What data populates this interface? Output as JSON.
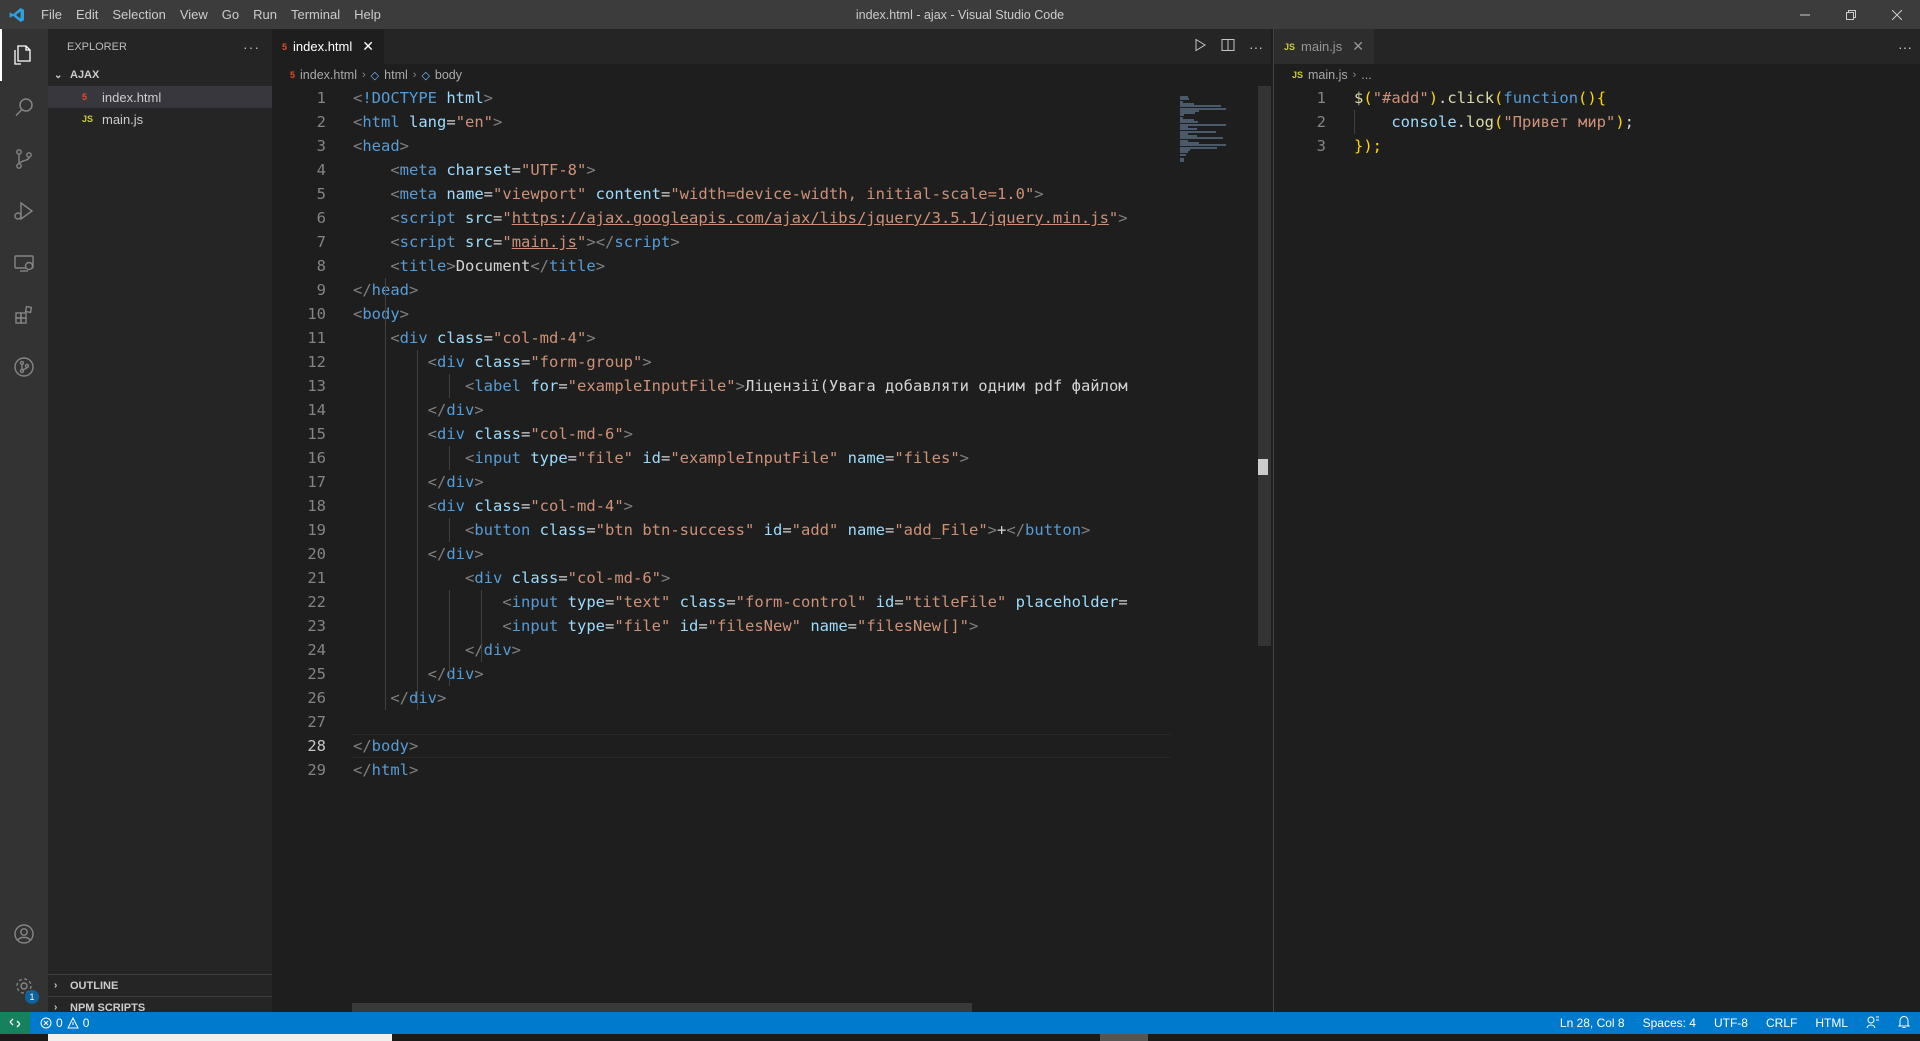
{
  "titlebar": {
    "menu": [
      "File",
      "Edit",
      "Selection",
      "View",
      "Go",
      "Run",
      "Terminal",
      "Help"
    ],
    "title": "index.html - ajax - Visual Studio Code",
    "minimize_icon": "minimize-icon",
    "restore_icon": "restore-icon",
    "close_icon": "close-icon"
  },
  "activitybar": {
    "icons": [
      "explorer-icon",
      "search-icon",
      "source-control-icon",
      "run-debug-icon",
      "remote-explorer-icon",
      "extensions-icon",
      "git-graph-icon"
    ],
    "bottom_icons": [
      "account-icon",
      "settings-gear-icon"
    ],
    "settings_badge": "1"
  },
  "sidebar": {
    "title": "EXPLORER",
    "more": "···",
    "folder": "AJAX",
    "files": [
      {
        "name": "index.html",
        "type": "html",
        "selected": true
      },
      {
        "name": "main.js",
        "type": "js",
        "selected": false
      }
    ],
    "outline": "OUTLINE",
    "npm_scripts": "NPM SCRIPTS"
  },
  "editor1": {
    "tab_label": "index.html",
    "tab_icon_text": "5",
    "tab_close": "✕",
    "actions": [
      "run-icon",
      "split-editor-icon",
      "more-actions-icon"
    ],
    "more": "···",
    "breadcrumb": [
      "index.html",
      "html",
      "body"
    ],
    "current_line": 28,
    "lines": [
      [
        [
          "t-punct",
          "<"
        ],
        [
          "t-tag",
          "!DOCTYPE "
        ],
        [
          "t-attr",
          "html"
        ],
        [
          "t-punct",
          ">"
        ]
      ],
      [
        [
          "t-punct",
          "<"
        ],
        [
          "t-tag",
          "html "
        ],
        [
          "t-attr",
          "lang"
        ],
        [
          "t-text",
          "="
        ],
        [
          "t-str",
          "\"en\""
        ],
        [
          "t-punct",
          ">"
        ]
      ],
      [
        [
          "t-punct",
          "<"
        ],
        [
          "t-tag",
          "head"
        ],
        [
          "t-punct",
          ">"
        ]
      ],
      [
        [
          "t-text",
          "    "
        ],
        [
          "t-punct",
          "<"
        ],
        [
          "t-tag",
          "meta "
        ],
        [
          "t-attr",
          "charset"
        ],
        [
          "t-text",
          "="
        ],
        [
          "t-str",
          "\"UTF-8\""
        ],
        [
          "t-punct",
          ">"
        ]
      ],
      [
        [
          "t-text",
          "    "
        ],
        [
          "t-punct",
          "<"
        ],
        [
          "t-tag",
          "meta "
        ],
        [
          "t-attr",
          "name"
        ],
        [
          "t-text",
          "="
        ],
        [
          "t-str",
          "\"viewport\" "
        ],
        [
          "t-attr",
          "content"
        ],
        [
          "t-text",
          "="
        ],
        [
          "t-str",
          "\"width=device-width, initial-scale=1.0\""
        ],
        [
          "t-punct",
          ">"
        ]
      ],
      [
        [
          "t-text",
          "    "
        ],
        [
          "t-punct",
          "<"
        ],
        [
          "t-tag",
          "script "
        ],
        [
          "t-attr",
          "src"
        ],
        [
          "t-text",
          "="
        ],
        [
          "t-str",
          "\""
        ],
        [
          "t-link",
          "https://ajax.googleapis.com/ajax/libs/jquery/3.5.1/jquery.min.js"
        ],
        [
          "t-str",
          "\""
        ],
        [
          "t-punct",
          ">"
        ]
      ],
      [
        [
          "t-text",
          "    "
        ],
        [
          "t-punct",
          "<"
        ],
        [
          "t-tag",
          "script "
        ],
        [
          "t-attr",
          "src"
        ],
        [
          "t-text",
          "="
        ],
        [
          "t-str",
          "\""
        ],
        [
          "t-link",
          "main.js"
        ],
        [
          "t-str",
          "\""
        ],
        [
          "t-punct",
          "></"
        ],
        [
          "t-tag",
          "script"
        ],
        [
          "t-punct",
          ">"
        ]
      ],
      [
        [
          "t-text",
          "    "
        ],
        [
          "t-punct",
          "<"
        ],
        [
          "t-tag",
          "title"
        ],
        [
          "t-punct",
          ">"
        ],
        [
          "t-text",
          "Document"
        ],
        [
          "t-punct",
          "</"
        ],
        [
          "t-tag",
          "title"
        ],
        [
          "t-punct",
          ">"
        ]
      ],
      [
        [
          "t-punct",
          "</"
        ],
        [
          "t-tag",
          "head"
        ],
        [
          "t-punct",
          ">"
        ]
      ],
      [
        [
          "t-punct",
          "<"
        ],
        [
          "t-tag",
          "body"
        ],
        [
          "t-punct",
          ">"
        ]
      ],
      [
        [
          "t-text",
          "    "
        ],
        [
          "t-punct",
          "<"
        ],
        [
          "t-tag",
          "div "
        ],
        [
          "t-attr",
          "class"
        ],
        [
          "t-text",
          "="
        ],
        [
          "t-str",
          "\"col-md-4\""
        ],
        [
          "t-punct",
          ">"
        ]
      ],
      [
        [
          "t-text",
          "        "
        ],
        [
          "t-punct",
          "<"
        ],
        [
          "t-tag",
          "div "
        ],
        [
          "t-attr",
          "class"
        ],
        [
          "t-text",
          "="
        ],
        [
          "t-str",
          "\"form-group\""
        ],
        [
          "t-punct",
          ">"
        ]
      ],
      [
        [
          "t-text",
          "            "
        ],
        [
          "t-punct",
          "<"
        ],
        [
          "t-tag",
          "label "
        ],
        [
          "t-attr",
          "for"
        ],
        [
          "t-text",
          "="
        ],
        [
          "t-str",
          "\"exampleInputFile\""
        ],
        [
          "t-punct",
          ">"
        ],
        [
          "t-text",
          "Ліцензії(Увага добавляти одним pdf файлом"
        ]
      ],
      [
        [
          "t-text",
          "        "
        ],
        [
          "t-punct",
          "</"
        ],
        [
          "t-tag",
          "div"
        ],
        [
          "t-punct",
          ">"
        ]
      ],
      [
        [
          "t-text",
          "        "
        ],
        [
          "t-punct",
          "<"
        ],
        [
          "t-tag",
          "div "
        ],
        [
          "t-attr",
          "class"
        ],
        [
          "t-text",
          "="
        ],
        [
          "t-str",
          "\"col-md-6\""
        ],
        [
          "t-punct",
          ">"
        ]
      ],
      [
        [
          "t-text",
          "            "
        ],
        [
          "t-punct",
          "<"
        ],
        [
          "t-tag",
          "input "
        ],
        [
          "t-attr",
          "type"
        ],
        [
          "t-text",
          "="
        ],
        [
          "t-str",
          "\"file\" "
        ],
        [
          "t-attr",
          "id"
        ],
        [
          "t-text",
          "="
        ],
        [
          "t-str",
          "\"exampleInputFile\" "
        ],
        [
          "t-attr",
          "name"
        ],
        [
          "t-text",
          "="
        ],
        [
          "t-str",
          "\"files\""
        ],
        [
          "t-punct",
          ">"
        ]
      ],
      [
        [
          "t-text",
          "        "
        ],
        [
          "t-punct",
          "</"
        ],
        [
          "t-tag",
          "div"
        ],
        [
          "t-punct",
          ">"
        ]
      ],
      [
        [
          "t-text",
          "        "
        ],
        [
          "t-punct",
          "<"
        ],
        [
          "t-tag",
          "div "
        ],
        [
          "t-attr",
          "class"
        ],
        [
          "t-text",
          "="
        ],
        [
          "t-str",
          "\"col-md-4\""
        ],
        [
          "t-punct",
          ">"
        ]
      ],
      [
        [
          "t-text",
          "            "
        ],
        [
          "t-punct",
          "<"
        ],
        [
          "t-tag",
          "button "
        ],
        [
          "t-attr",
          "class"
        ],
        [
          "t-text",
          "="
        ],
        [
          "t-str",
          "\"btn btn-success\" "
        ],
        [
          "t-attr",
          "id"
        ],
        [
          "t-text",
          "="
        ],
        [
          "t-str",
          "\"add\" "
        ],
        [
          "t-attr",
          "name"
        ],
        [
          "t-text",
          "="
        ],
        [
          "t-str",
          "\"add_File\""
        ],
        [
          "t-punct",
          ">"
        ],
        [
          "t-text",
          "+"
        ],
        [
          "t-punct",
          "</"
        ],
        [
          "t-tag",
          "button"
        ],
        [
          "t-punct",
          ">"
        ]
      ],
      [
        [
          "t-text",
          "        "
        ],
        [
          "t-punct",
          "</"
        ],
        [
          "t-tag",
          "div"
        ],
        [
          "t-punct",
          ">"
        ]
      ],
      [
        [
          "t-text",
          "            "
        ],
        [
          "t-punct",
          "<"
        ],
        [
          "t-tag",
          "div "
        ],
        [
          "t-attr",
          "class"
        ],
        [
          "t-text",
          "="
        ],
        [
          "t-str",
          "\"col-md-6\""
        ],
        [
          "t-punct",
          ">"
        ]
      ],
      [
        [
          "t-text",
          "                "
        ],
        [
          "t-punct",
          "<"
        ],
        [
          "t-tag",
          "input "
        ],
        [
          "t-attr",
          "type"
        ],
        [
          "t-text",
          "="
        ],
        [
          "t-str",
          "\"text\" "
        ],
        [
          "t-attr",
          "class"
        ],
        [
          "t-text",
          "="
        ],
        [
          "t-str",
          "\"form-control\" "
        ],
        [
          "t-attr",
          "id"
        ],
        [
          "t-text",
          "="
        ],
        [
          "t-str",
          "\"titleFile\" "
        ],
        [
          "t-attr",
          "placeholder"
        ],
        [
          "t-text",
          "="
        ]
      ],
      [
        [
          "t-text",
          "                "
        ],
        [
          "t-punct",
          "<"
        ],
        [
          "t-tag",
          "input "
        ],
        [
          "t-attr",
          "type"
        ],
        [
          "t-text",
          "="
        ],
        [
          "t-str",
          "\"file\" "
        ],
        [
          "t-attr",
          "id"
        ],
        [
          "t-text",
          "="
        ],
        [
          "t-str",
          "\"filesNew\" "
        ],
        [
          "t-attr",
          "name"
        ],
        [
          "t-text",
          "="
        ],
        [
          "t-str",
          "\"filesNew[]\""
        ],
        [
          "t-punct",
          ">"
        ]
      ],
      [
        [
          "t-text",
          "            "
        ],
        [
          "t-punct",
          "</"
        ],
        [
          "t-tag",
          "div"
        ],
        [
          "t-punct",
          ">"
        ]
      ],
      [
        [
          "t-text",
          "        "
        ],
        [
          "t-punct",
          "</"
        ],
        [
          "t-tag",
          "div"
        ],
        [
          "t-punct",
          ">"
        ]
      ],
      [
        [
          "t-text",
          "    "
        ],
        [
          "t-punct",
          "</"
        ],
        [
          "t-tag",
          "div"
        ],
        [
          "t-punct",
          ">"
        ]
      ],
      [
        [
          "t-text",
          ""
        ]
      ],
      [
        [
          "t-punct",
          "</"
        ],
        [
          "t-tag",
          "body"
        ],
        [
          "t-punct",
          ">"
        ]
      ],
      [
        [
          "t-punct",
          "</"
        ],
        [
          "t-tag",
          "html"
        ],
        [
          "t-punct",
          ">"
        ]
      ]
    ]
  },
  "editor2": {
    "tab_label": "main.js",
    "tab_icon_text": "JS",
    "tab_close": "✕",
    "more": "···",
    "breadcrumb": [
      "main.js",
      "..."
    ],
    "lines": [
      [
        [
          "t-yellow",
          "$"
        ],
        [
          "t-brace",
          "("
        ],
        [
          "t-str",
          "\"#add\""
        ],
        [
          "t-brace",
          ")"
        ],
        [
          "t-text",
          "."
        ],
        [
          "t-yellow",
          "click"
        ],
        [
          "t-brace",
          "("
        ],
        [
          "t-tag",
          "function"
        ],
        [
          "t-brace",
          "(){"
        ]
      ],
      [
        [
          "t-text",
          "    "
        ],
        [
          "t-attr",
          "console"
        ],
        [
          "t-text",
          "."
        ],
        [
          "t-yellow",
          "log"
        ],
        [
          "t-brace",
          "("
        ],
        [
          "t-str",
          "\"Привет мир\""
        ],
        [
          "t-brace",
          ")"
        ],
        [
          "t-text",
          ";"
        ]
      ],
      [
        [
          "t-brace",
          "});"
        ]
      ]
    ]
  },
  "statusbar": {
    "remote_icon": "remote-icon",
    "errors": "0",
    "warnings": "0",
    "position": "Ln 28, Col 8",
    "spaces": "Spaces: 4",
    "encoding": "UTF-8",
    "eol": "CRLF",
    "language": "HTML",
    "feedback_icon": "feedback-icon",
    "bell_icon": "bell-icon"
  },
  "colors": {
    "status_bar": "#007acc",
    "activity_bar": "#333333",
    "sidebar": "#252526",
    "editor": "#1e1e1e"
  }
}
